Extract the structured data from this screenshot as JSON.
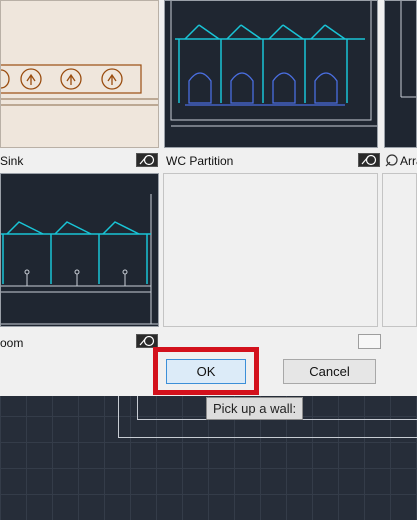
{
  "tiles": [
    {
      "label": "Sink"
    },
    {
      "label": "WC Partition"
    },
    {
      "label": "Arran"
    },
    {
      "label": "oom"
    }
  ],
  "buttons": {
    "ok_label": "OK",
    "cancel_label": "Cancel"
  },
  "tooltip": {
    "text": "Pick up a wall:"
  },
  "colors": {
    "highlight": "#d3111c",
    "cad_cyan": "#19c4d6",
    "cad_blue": "#4a6ee0",
    "sink_brown": "#9a4d10"
  }
}
